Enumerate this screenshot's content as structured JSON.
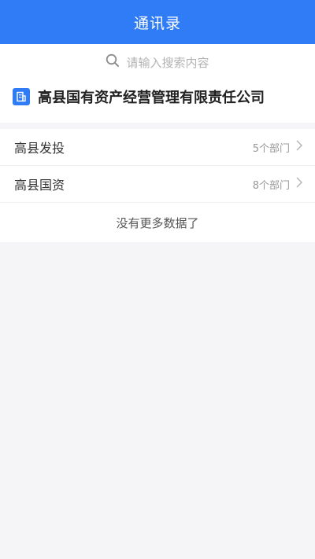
{
  "header": {
    "title": "通讯录"
  },
  "search": {
    "placeholder": "请输入搜索内容"
  },
  "org": {
    "name": "高县国有资产经营管理有限责任公司"
  },
  "list": {
    "items": [
      {
        "label": "高县发投",
        "count": "5个部门"
      },
      {
        "label": "高县国资",
        "count": "8个部门"
      }
    ],
    "end_text": "没有更多数据了"
  },
  "colors": {
    "primary": "#2f7cf6",
    "background": "#f5f5f7"
  },
  "icons": {
    "search": "search-icon",
    "org": "building-icon",
    "row": "chevron-right-icon"
  }
}
